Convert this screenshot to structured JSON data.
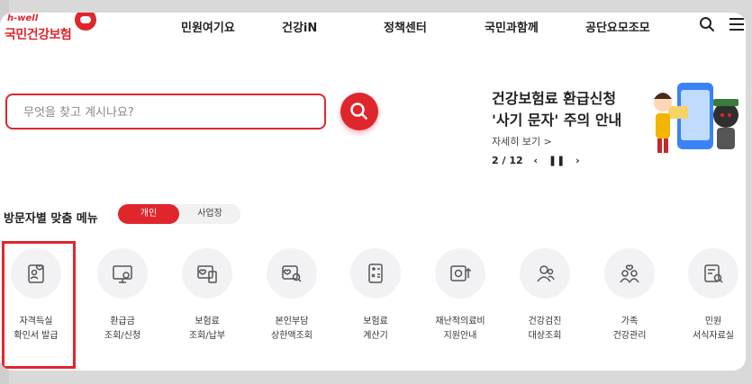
{
  "brand": {
    "tagline": "h-well",
    "name": "국민건강보험"
  },
  "nav": {
    "items": [
      "민원여기요",
      "건강iN",
      "정책센터",
      "국민과함께",
      "공단요모조모"
    ]
  },
  "search": {
    "placeholder": "무엇을 찾고 계시나요?"
  },
  "banner": {
    "title_line1": "건강보험료 환급신청",
    "title_line2": "'사기 문자' 주의 안내",
    "more": "자세히 보기 >",
    "page": "2 / 12"
  },
  "section": {
    "title": "방문자별 맞춤 메뉴",
    "toggle_on": "개인",
    "toggle_off": "사업장"
  },
  "menu": [
    {
      "l1": "자격득실",
      "l2": "확인서 발급"
    },
    {
      "l1": "환급금",
      "l2": "조회/신청"
    },
    {
      "l1": "보험료",
      "l2": "조회/납부"
    },
    {
      "l1": "본인부담",
      "l2": "상한액조회"
    },
    {
      "l1": "보험료",
      "l2": "계산기"
    },
    {
      "l1": "재난적의료비",
      "l2": "지원안내"
    },
    {
      "l1": "건강검진",
      "l2": "대상조회"
    },
    {
      "l1": "가족",
      "l2": "건강관리"
    },
    {
      "l1": "민원",
      "l2": "서식자료실"
    }
  ],
  "colors": {
    "accent": "#e0262d",
    "icon_bg": "#f2f2f4",
    "icon_stroke": "#555555"
  }
}
